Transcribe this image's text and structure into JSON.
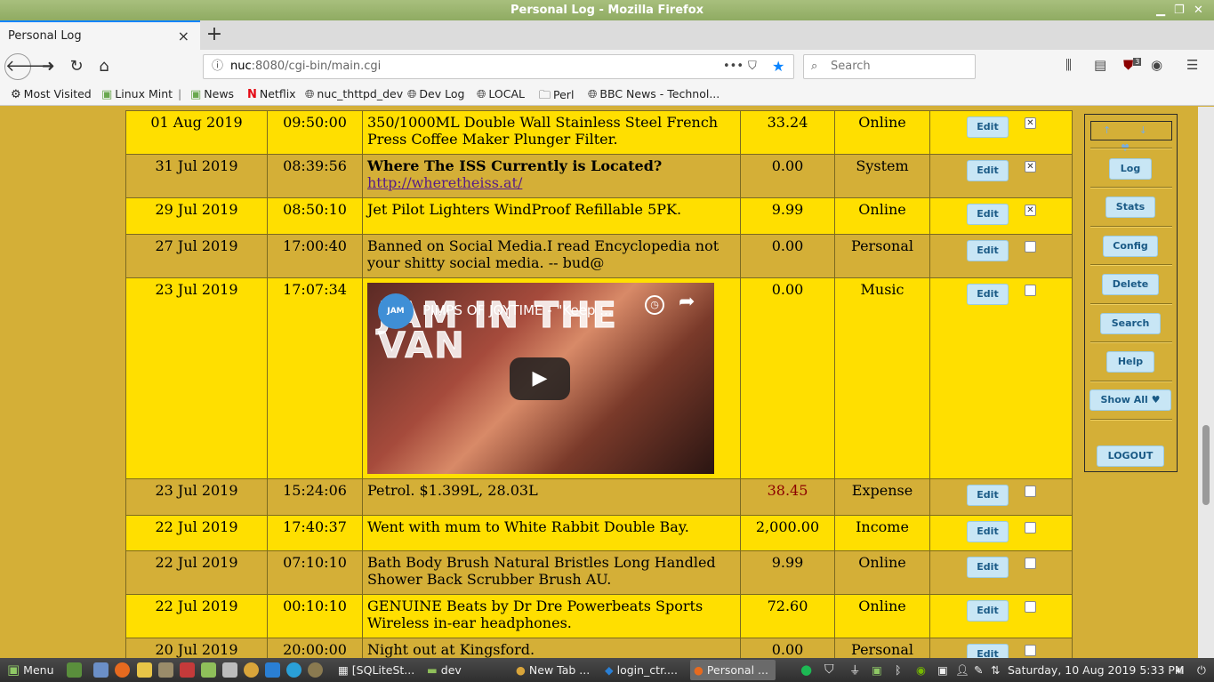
{
  "window": {
    "title": "Personal Log - Mozilla Firefox"
  },
  "tabs": [
    {
      "label": "Personal Log",
      "close": "×"
    }
  ],
  "newtab_label": "+",
  "nav": {
    "url_host": "nuc",
    "url_rest": ":8080/cgi-bin/main.cgi",
    "search_placeholder": "Search",
    "ublock_count": "3"
  },
  "bookmarks": [
    {
      "label": "Most Visited",
      "icon": "gear-icon"
    },
    {
      "label": "Linux Mint",
      "icon": "mint-icon"
    },
    {
      "label": "News",
      "icon": "mint-icon"
    },
    {
      "label": "Netflix",
      "icon": "netflix-icon"
    },
    {
      "label": "nuc_thttpd_dev",
      "icon": "globe-icon"
    },
    {
      "label": "Dev Log",
      "icon": "globe-icon"
    },
    {
      "label": "LOCAL",
      "icon": "globe-icon"
    },
    {
      "label": "Perl",
      "icon": "folder-icon"
    },
    {
      "label": "BBC News - Technol...",
      "icon": "globe-icon"
    }
  ],
  "log": {
    "edit_label": "Edit",
    "rows": [
      {
        "date": "01 Aug 2019",
        "time": "09:50:00",
        "desc": "350/1000ML Double Wall Stainless Steel French Press Coffee Maker Plunger Filter.",
        "amount": "33.24",
        "category": "Online",
        "checked": true
      },
      {
        "date": "31 Jul 2019",
        "time": "08:39:56",
        "desc_bold": "Where The ISS Currently is Located?",
        "link": "http://wheretheiss.at/",
        "amount": "0.00",
        "category": "System",
        "checked": true
      },
      {
        "date": "29 Jul 2019",
        "time": "08:50:10",
        "desc": "Jet Pilot Lighters WindProof Refillable 5PK.",
        "amount": "9.99",
        "category": "Online",
        "checked": true
      },
      {
        "date": "27 Jul 2019",
        "time": "17:00:40",
        "desc": "Banned on Social Media.I read Encyclopedia not your shitty social media. -- bud@",
        "amount": "0.00",
        "category": "Personal",
        "checked": false
      },
      {
        "date": "23 Jul 2019",
        "time": "17:07:34",
        "video_title": "PIMPS OF JOYTIME - \"Keep ...",
        "video_channel": "JAM IN THE VAN",
        "amount": "0.00",
        "category": "Music",
        "checked": false
      },
      {
        "date": "23 Jul 2019",
        "time": "15:24:06",
        "desc": "Petrol. $1.399L, 28.03L",
        "amount": "38.45",
        "category": "Expense",
        "checked": false
      },
      {
        "date": "22 Jul 2019",
        "time": "17:40:37",
        "desc": "Went with mum to White Rabbit Double Bay.",
        "amount": "2,000.00",
        "category": "Income",
        "checked": false
      },
      {
        "date": "22 Jul 2019",
        "time": "07:10:10",
        "desc": "Bath Body Brush Natural Bristles Long Handled Shower Back Scrubber Brush AU.",
        "amount": "9.99",
        "category": "Online",
        "checked": false
      },
      {
        "date": "22 Jul 2019",
        "time": "00:10:10",
        "desc": "GENUINE Beats by Dr Dre Powerbeats Sports Wireless in-ear headphones.",
        "amount": "72.60",
        "category": "Online",
        "checked": false
      },
      {
        "date": "20 Jul 2019",
        "time": "20:00:00",
        "desc": "Night out at Kingsford.",
        "amount": "0.00",
        "category": "Personal",
        "checked": false
      }
    ]
  },
  "sidenav": {
    "arrows": "↑ ↓ ♥",
    "buttons": [
      "Log",
      "Stats",
      "Config",
      "Delete",
      "Search",
      "Help",
      "Show All ♥"
    ],
    "logout": "LOGOUT"
  },
  "taskbar": {
    "menu_label": "Menu",
    "tasks": [
      "[SQLiteSt...",
      "dev",
      "New Tab ...",
      "login_ctr....",
      "Personal ..."
    ],
    "clock": "Saturday, 10 Aug 2019  5:33 PM"
  }
}
